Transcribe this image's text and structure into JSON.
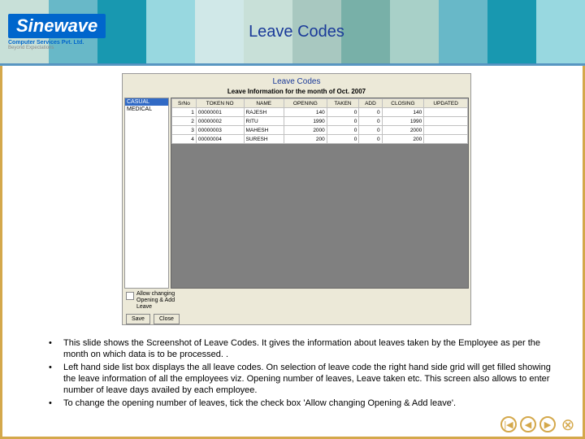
{
  "colors": {
    "stripes": [
      "#c8e0d8",
      "#68b8c8",
      "#1898b0",
      "#98d8e0",
      "#d0e8e8",
      "#c8e0d8",
      "#a8c8c0",
      "#78b0a8",
      "#a8d0c8",
      "#68b8c8",
      "#1898b0",
      "#98d8e0"
    ]
  },
  "logo": {
    "name": "Sinewave",
    "line1": "Computer Services Pvt. Ltd.",
    "line2": "Beyond Expectations"
  },
  "slide_title": "Leave Codes",
  "app": {
    "title": "Leave Codes",
    "subtitle": "Leave Information for the month of Oct. 2007",
    "left_items": [
      "CASUAL",
      "MEDICAL"
    ],
    "headers": [
      "SrNo",
      "TOKEN NO",
      "NAME",
      "OPENING",
      "TAKEN",
      "ADD",
      "CLOSING",
      "UPDATED"
    ],
    "rows": [
      [
        "1",
        "00000001",
        "RAJESH",
        "140",
        "0",
        "0",
        "140",
        ""
      ],
      [
        "2",
        "00000002",
        "RITU",
        "1990",
        "0",
        "0",
        "1990",
        ""
      ],
      [
        "3",
        "00000003",
        "MAHESH",
        "2000",
        "0",
        "0",
        "2000",
        ""
      ],
      [
        "4",
        "00000004",
        "SURESH",
        "200",
        "0",
        "0",
        "200",
        ""
      ]
    ],
    "checkbox_label": "Allow changing Opening & Add Leave",
    "buttons": {
      "save": "Save",
      "close": "Close"
    }
  },
  "bullets": [
    "This slide shows the Screenshot of Leave Codes. It gives the information about leaves taken by the Employee as per the month on which data is to be processed. .",
    "Left hand side list box displays the all leave codes. On selection of leave code the right hand side grid will get filled showing the leave information of all the employees viz. Opening number of leaves, Leave taken etc. This screen also allows to enter number of leave days availed by each employee.",
    "To change the opening number of leaves, tick the check box 'Allow changing Opening & Add leave'."
  ],
  "nav": {
    "first": "|◀",
    "prev": "◀",
    "next": "▶",
    "close": "⊗"
  }
}
